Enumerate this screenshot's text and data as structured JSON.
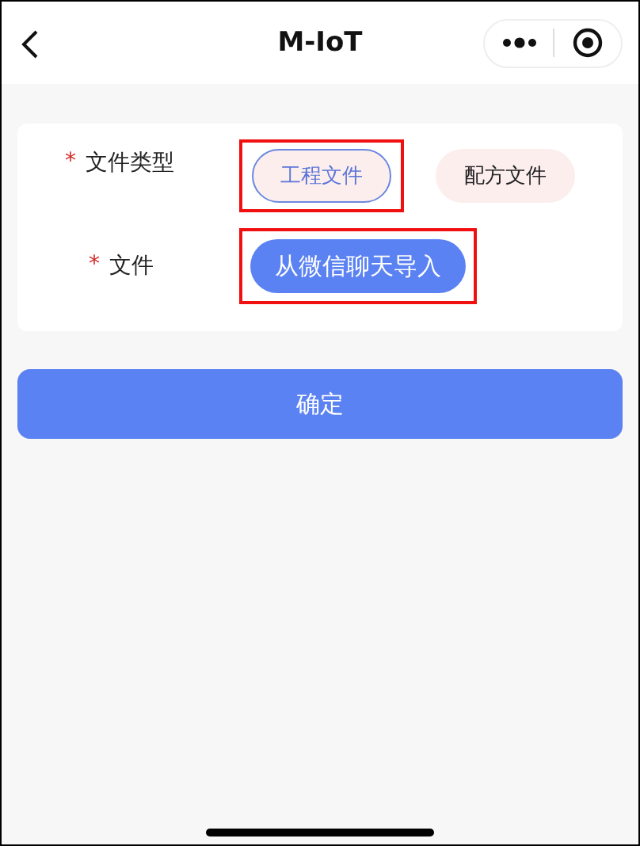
{
  "window": {
    "title": "M-IoT"
  },
  "form": {
    "fields": [
      {
        "kind": "choice",
        "label": "文件类型",
        "required_mark": "*",
        "options": [
          {
            "label": "工程文件",
            "selected": true,
            "highlighted": true
          },
          {
            "label": "配方文件",
            "selected": false,
            "highlighted": false
          }
        ]
      },
      {
        "kind": "action",
        "label": "文件",
        "required_mark": "*",
        "button": {
          "label": "从微信聊天导入",
          "highlighted": true
        }
      }
    ]
  },
  "submit": {
    "label": "确定"
  }
}
